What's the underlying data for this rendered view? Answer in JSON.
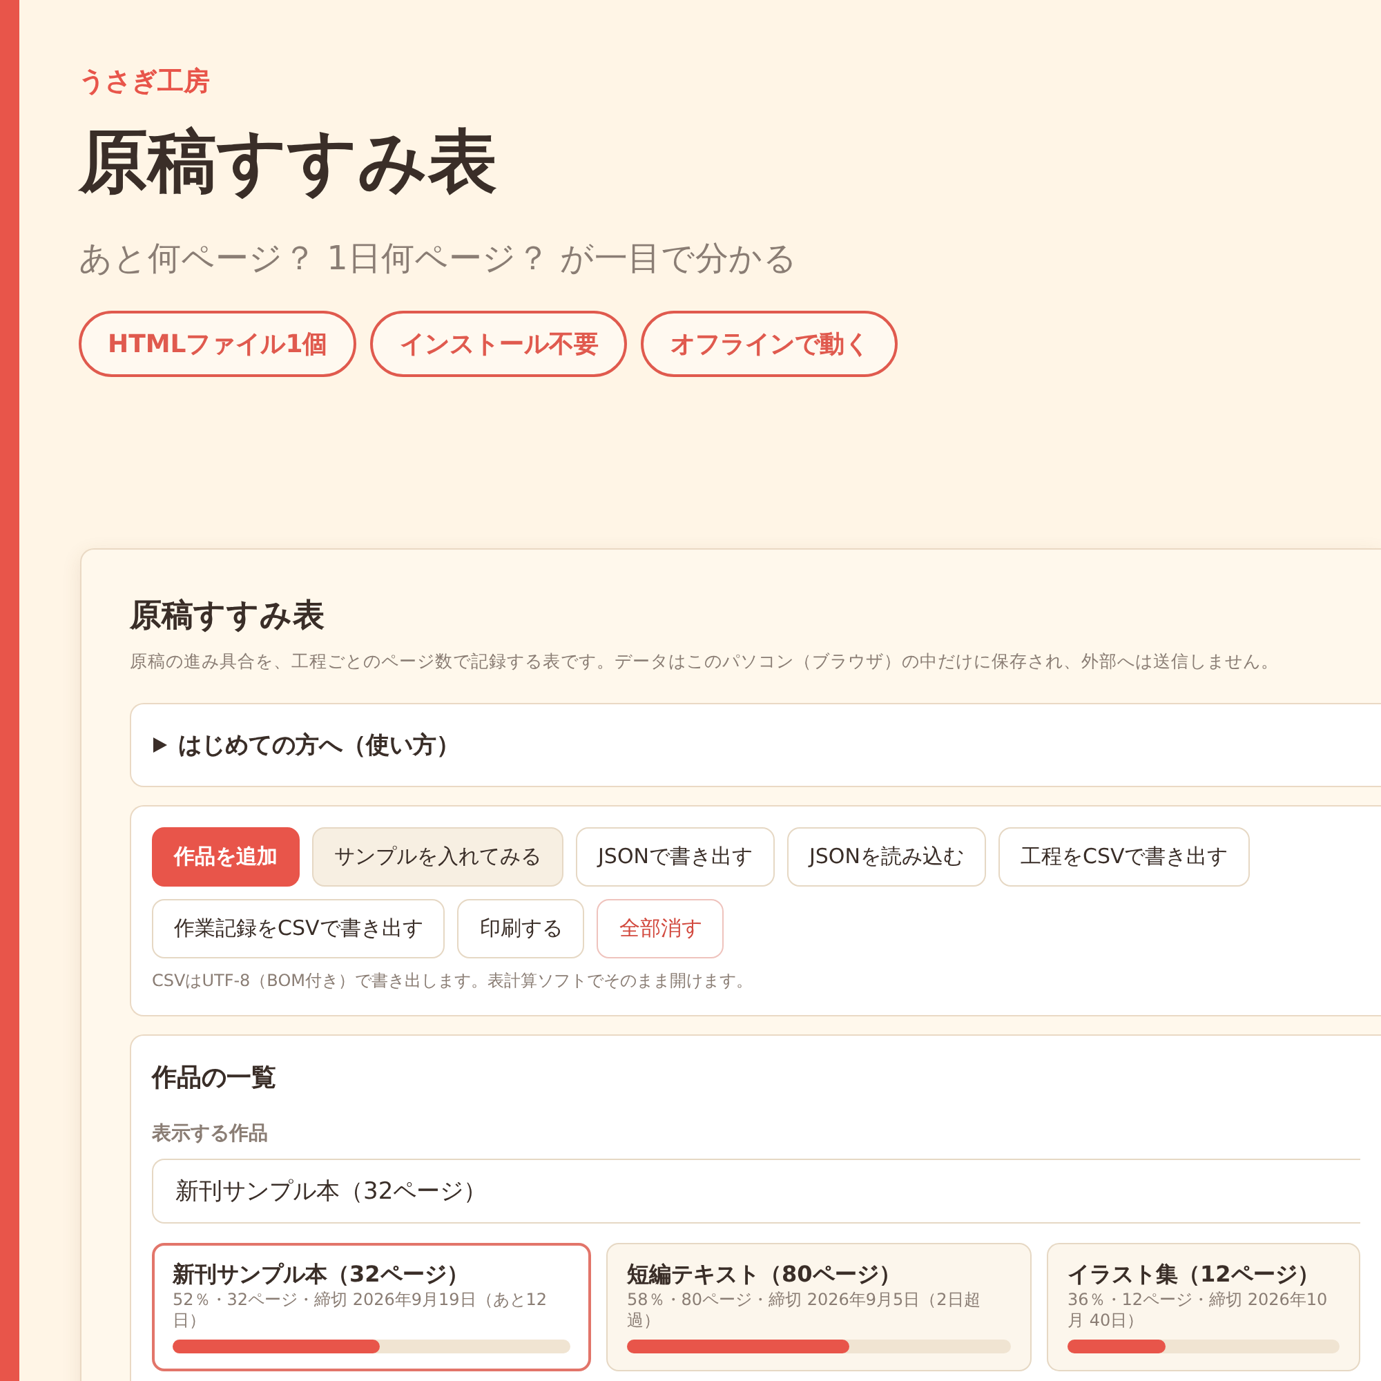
{
  "brand": "うさぎ工房",
  "title": "原稿すすみ表",
  "subtitle": "あと何ページ？ 1日何ページ？ が一目で分かる",
  "badges": [
    "HTMLファイル1個",
    "インストール不要",
    "オフラインで動く"
  ],
  "panel": {
    "title": "原稿すすみ表",
    "description": "原稿の進み具合を、工程ごとのページ数で記録する表です。データはこのパソコン（ブラウザ）の中だけに保存され、外部へは送信しません。",
    "guide": {
      "label": "はじめての方へ（使い方）",
      "expanded": false
    },
    "toolbar": {
      "buttons": [
        {
          "label": "作品を追加",
          "kind": "primary"
        },
        {
          "label": "サンプルを入れてみる",
          "kind": "soft"
        },
        {
          "label": "JSONで書き出す",
          "kind": "plain"
        },
        {
          "label": "JSONを読み込む",
          "kind": "plain"
        },
        {
          "label": "工程をCSVで書き出す",
          "kind": "plain"
        },
        {
          "label": "作業記録をCSVで書き出す",
          "kind": "plain"
        },
        {
          "label": "印刷する",
          "kind": "plain"
        },
        {
          "label": "全部消す",
          "kind": "danger"
        }
      ],
      "note": "CSVはUTF-8（BOM付き）で書き出します。表計算ソフトでそのまま開けます。"
    },
    "works": {
      "title": "作品の一覧",
      "select_label": "表示する作品",
      "select_value": "新刊サンプル本（32ページ）",
      "cards": [
        {
          "name": "新刊サンプル本（32ページ）",
          "detail": "52％・32ページ・締切 2026年9月19日（あと12日）",
          "level": 0.52,
          "selected": true
        },
        {
          "name": "短編テキスト（80ページ）",
          "detail": "58％・80ページ・締切 2026年9月5日（2日超過）",
          "level": 0.58,
          "selected": false
        },
        {
          "name": "イラスト集（12ページ）",
          "detail": "36％・12ページ・締切 2026年10月 40日）",
          "level": 0.36,
          "selected": false
        }
      ]
    }
  }
}
